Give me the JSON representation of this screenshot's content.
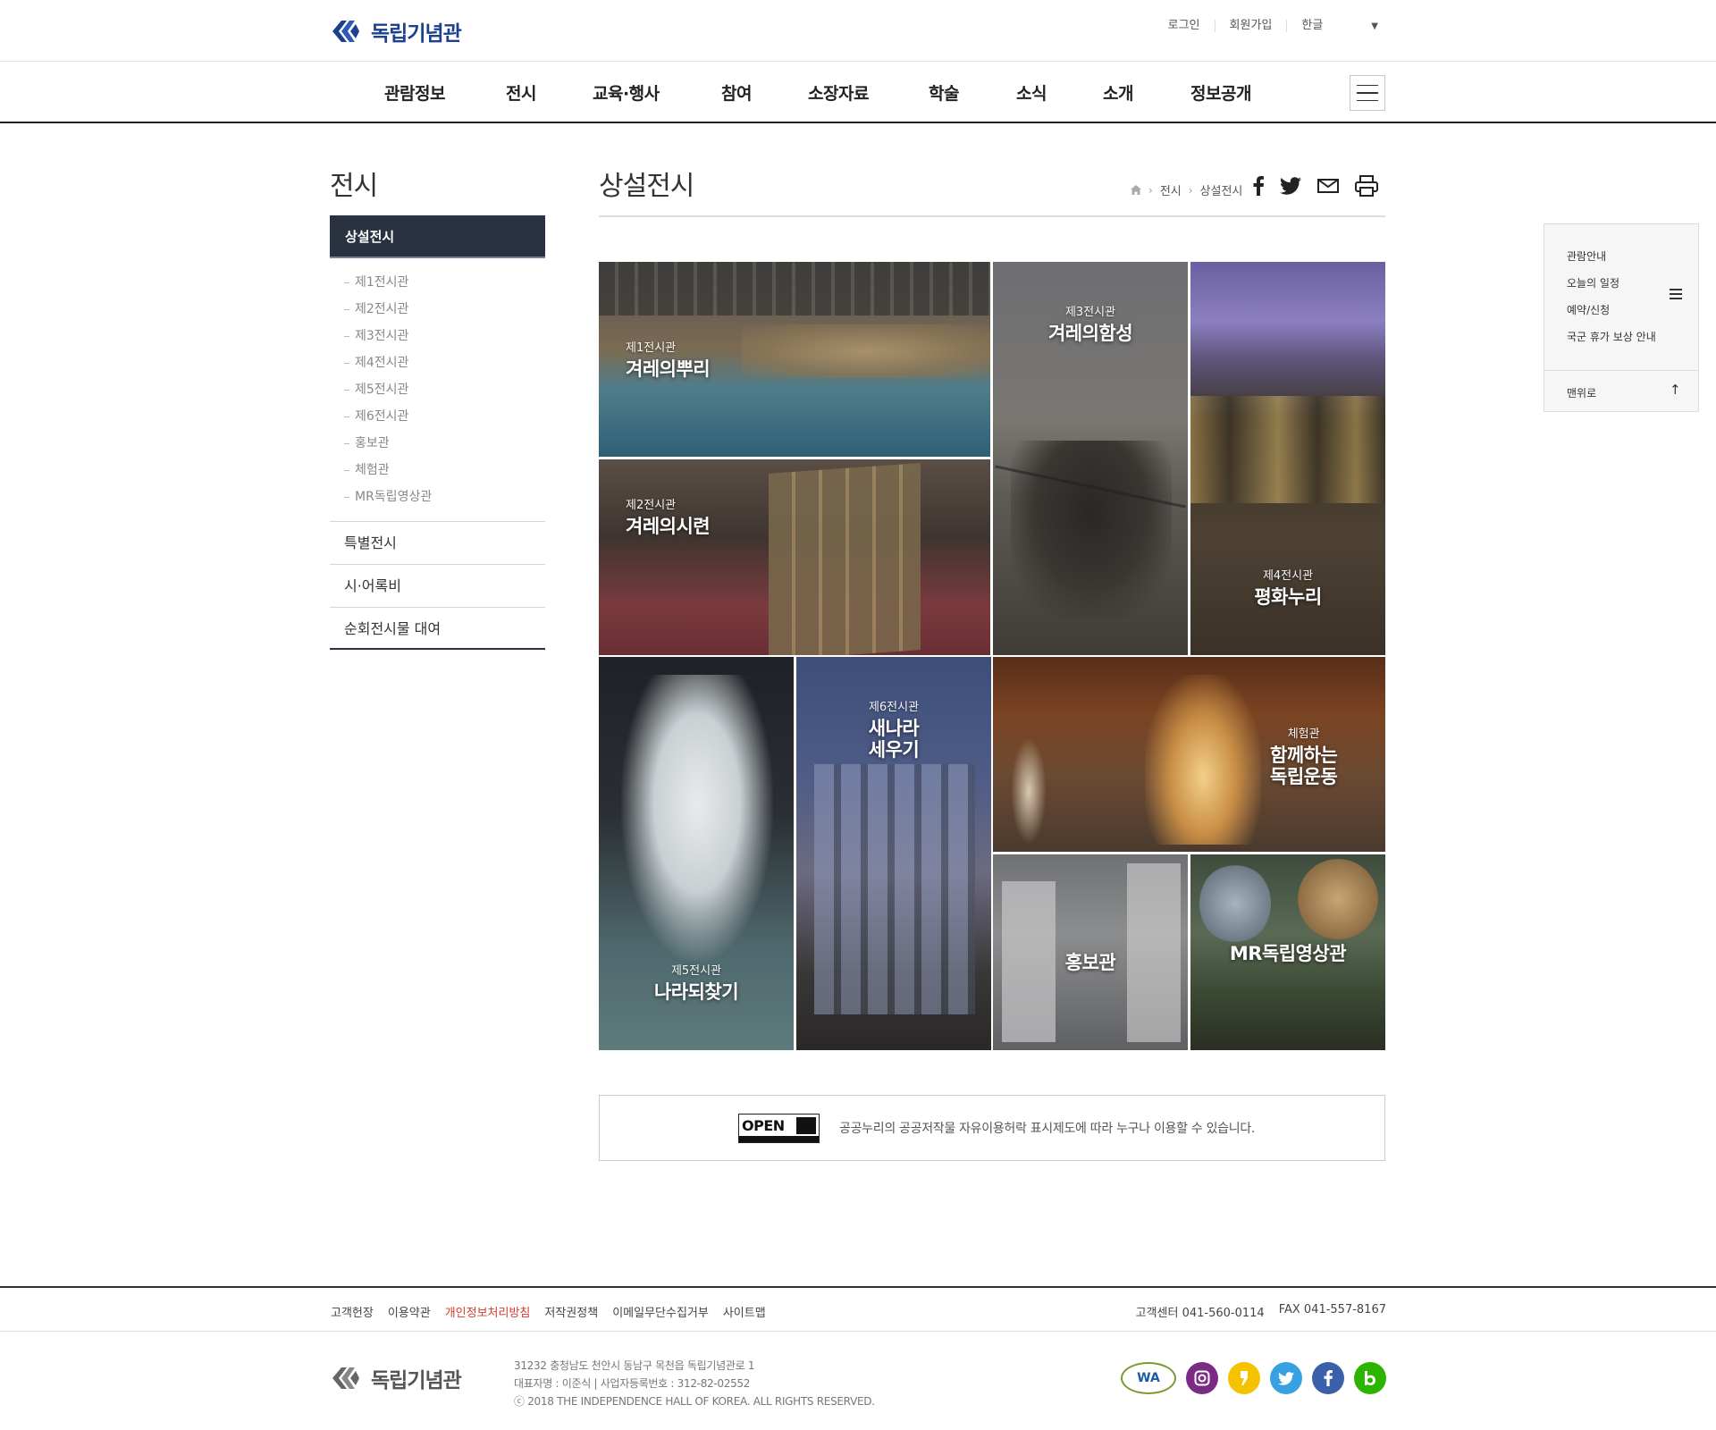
{
  "header": {
    "logo_text": "독립기념관",
    "util": {
      "login": "로그인",
      "signup": "회원가입",
      "lang": "한글"
    },
    "gnb": [
      "관람정보",
      "전시",
      "교육·행사",
      "참여",
      "소장자료",
      "학술",
      "소식",
      "소개",
      "정보공개"
    ]
  },
  "lnb": {
    "title": "전시",
    "active": "상설전시",
    "sub": [
      "제1전시관",
      "제2전시관",
      "제3전시관",
      "제4전시관",
      "제5전시관",
      "제6전시관",
      "홍보관",
      "체험관",
      "MR독립영상관"
    ],
    "items": [
      "특별전시",
      "시·어록비",
      "순회전시물 대여"
    ]
  },
  "content": {
    "title": "상설전시",
    "breadcrumb": [
      "전시",
      "상설전시"
    ]
  },
  "gallery": [
    {
      "num": "제1전시관",
      "name": "겨레의뿌리"
    },
    {
      "num": "제3전시관",
      "name": "겨레의함성"
    },
    {
      "num": "제2전시관",
      "name": "겨레의시련"
    },
    {
      "num": "제4전시관",
      "name": "평화누리"
    },
    {
      "num": "제5전시관",
      "name": "나라되찾기"
    },
    {
      "num": "제6전시관",
      "name": "새나라\n세우기"
    },
    {
      "num": "체험관",
      "name": "함께하는\n독립운동"
    },
    {
      "num": "",
      "name": "홍보관"
    },
    {
      "num": "",
      "name": "MR독립영상관"
    }
  ],
  "kogl": {
    "badge": "OPEN",
    "text": "공공누리의 공공저작물 자유이용허락 표시제도에 따라 누구나 이용할 수 있습니다."
  },
  "quick": {
    "items": [
      "관람안내",
      "오늘의 일정",
      "예약/신청",
      "국군 휴가 보상 안내"
    ],
    "top": "맨위로"
  },
  "footer": {
    "nav": [
      "고객헌장",
      "이용약관",
      "개인정보처리방침",
      "저작권정책",
      "이메일무단수집거부",
      "사이트맵"
    ],
    "contact": [
      "고객센터 041-560-0114",
      "FAX 041-557-8167"
    ],
    "logo_text": "독립기념관",
    "info": [
      "31232 충청남도 천안시 동남구 목천읍 독립기념관로 1",
      "대표자명 : 이준식  |  사업자등록번호 : 312-82-02552",
      "ⓒ 2018 THE INDEPENDENCE HALL OF KOREA. ALL RIGHTS RESERVED."
    ],
    "sns": [
      {
        "icon": "wa-mark-icon",
        "label": "WA"
      },
      {
        "icon": "instagram-icon",
        "color": "#7b2b84"
      },
      {
        "icon": "kakaostory-icon",
        "color": "#f5c200"
      },
      {
        "icon": "twitter-icon",
        "color": "#38a1e1"
      },
      {
        "icon": "facebook-icon",
        "color": "#3b5fa8"
      },
      {
        "icon": "blog-icon",
        "color": "#2db400"
      }
    ]
  }
}
